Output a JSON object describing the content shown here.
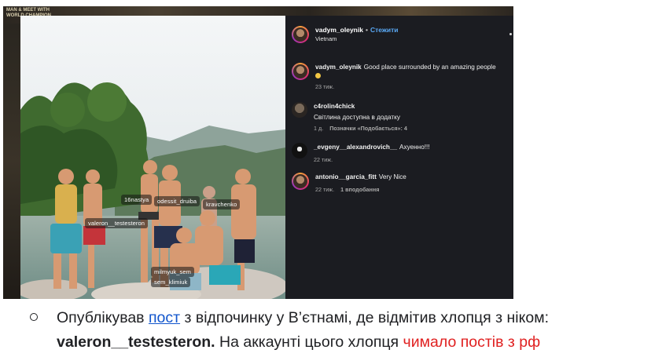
{
  "background": {
    "caption_line1": "MAN & MEET WITH",
    "caption_line2": "WORLD CHAMPION"
  },
  "photo": {
    "tags": [
      "16nastya",
      "odessit_druiba",
      "kravchenko",
      "valeron__testesteron",
      "milmyuk_sem",
      "sem_klimiuk"
    ]
  },
  "post": {
    "username": "vadym_oleynik",
    "separator": "•",
    "follow_label": "Стежити",
    "location": "Vietnam"
  },
  "comments": [
    {
      "user": "vadym_oleynik",
      "text": "Good place surrounded by an amazing people",
      "emoji": "smile-emoji",
      "time": "23 тиж.",
      "extra": ""
    },
    {
      "user": "c4rolin4chick",
      "text": "Світлина доступна в додатку",
      "time": "1 д.",
      "extra": "Позначки «Подобається»: 4"
    },
    {
      "user": "_evgeny__alexandrovich__",
      "text": "Ахуенно!!!",
      "time": "22 тиж.",
      "extra": ""
    },
    {
      "user": "antonio__garcia_fitt",
      "text": "Very Nice",
      "time": "22 тиж.",
      "extra": "1 вподобання"
    }
  ],
  "caption": {
    "part1": "Опублікував ",
    "link": "пост",
    "part2": " з відпочинку у В’єтнамі, де відмітив хлопця з ніком:",
    "nick": "valeron__testesteron.",
    "part3": " На аккаунті цього хлопця ",
    "highlight": "чимало постів з рф"
  },
  "colors": {
    "accent_link": "#1155cc",
    "highlight": "#e02020",
    "follow": "#5aa9f5",
    "panel_bg": "#1b1c21"
  }
}
